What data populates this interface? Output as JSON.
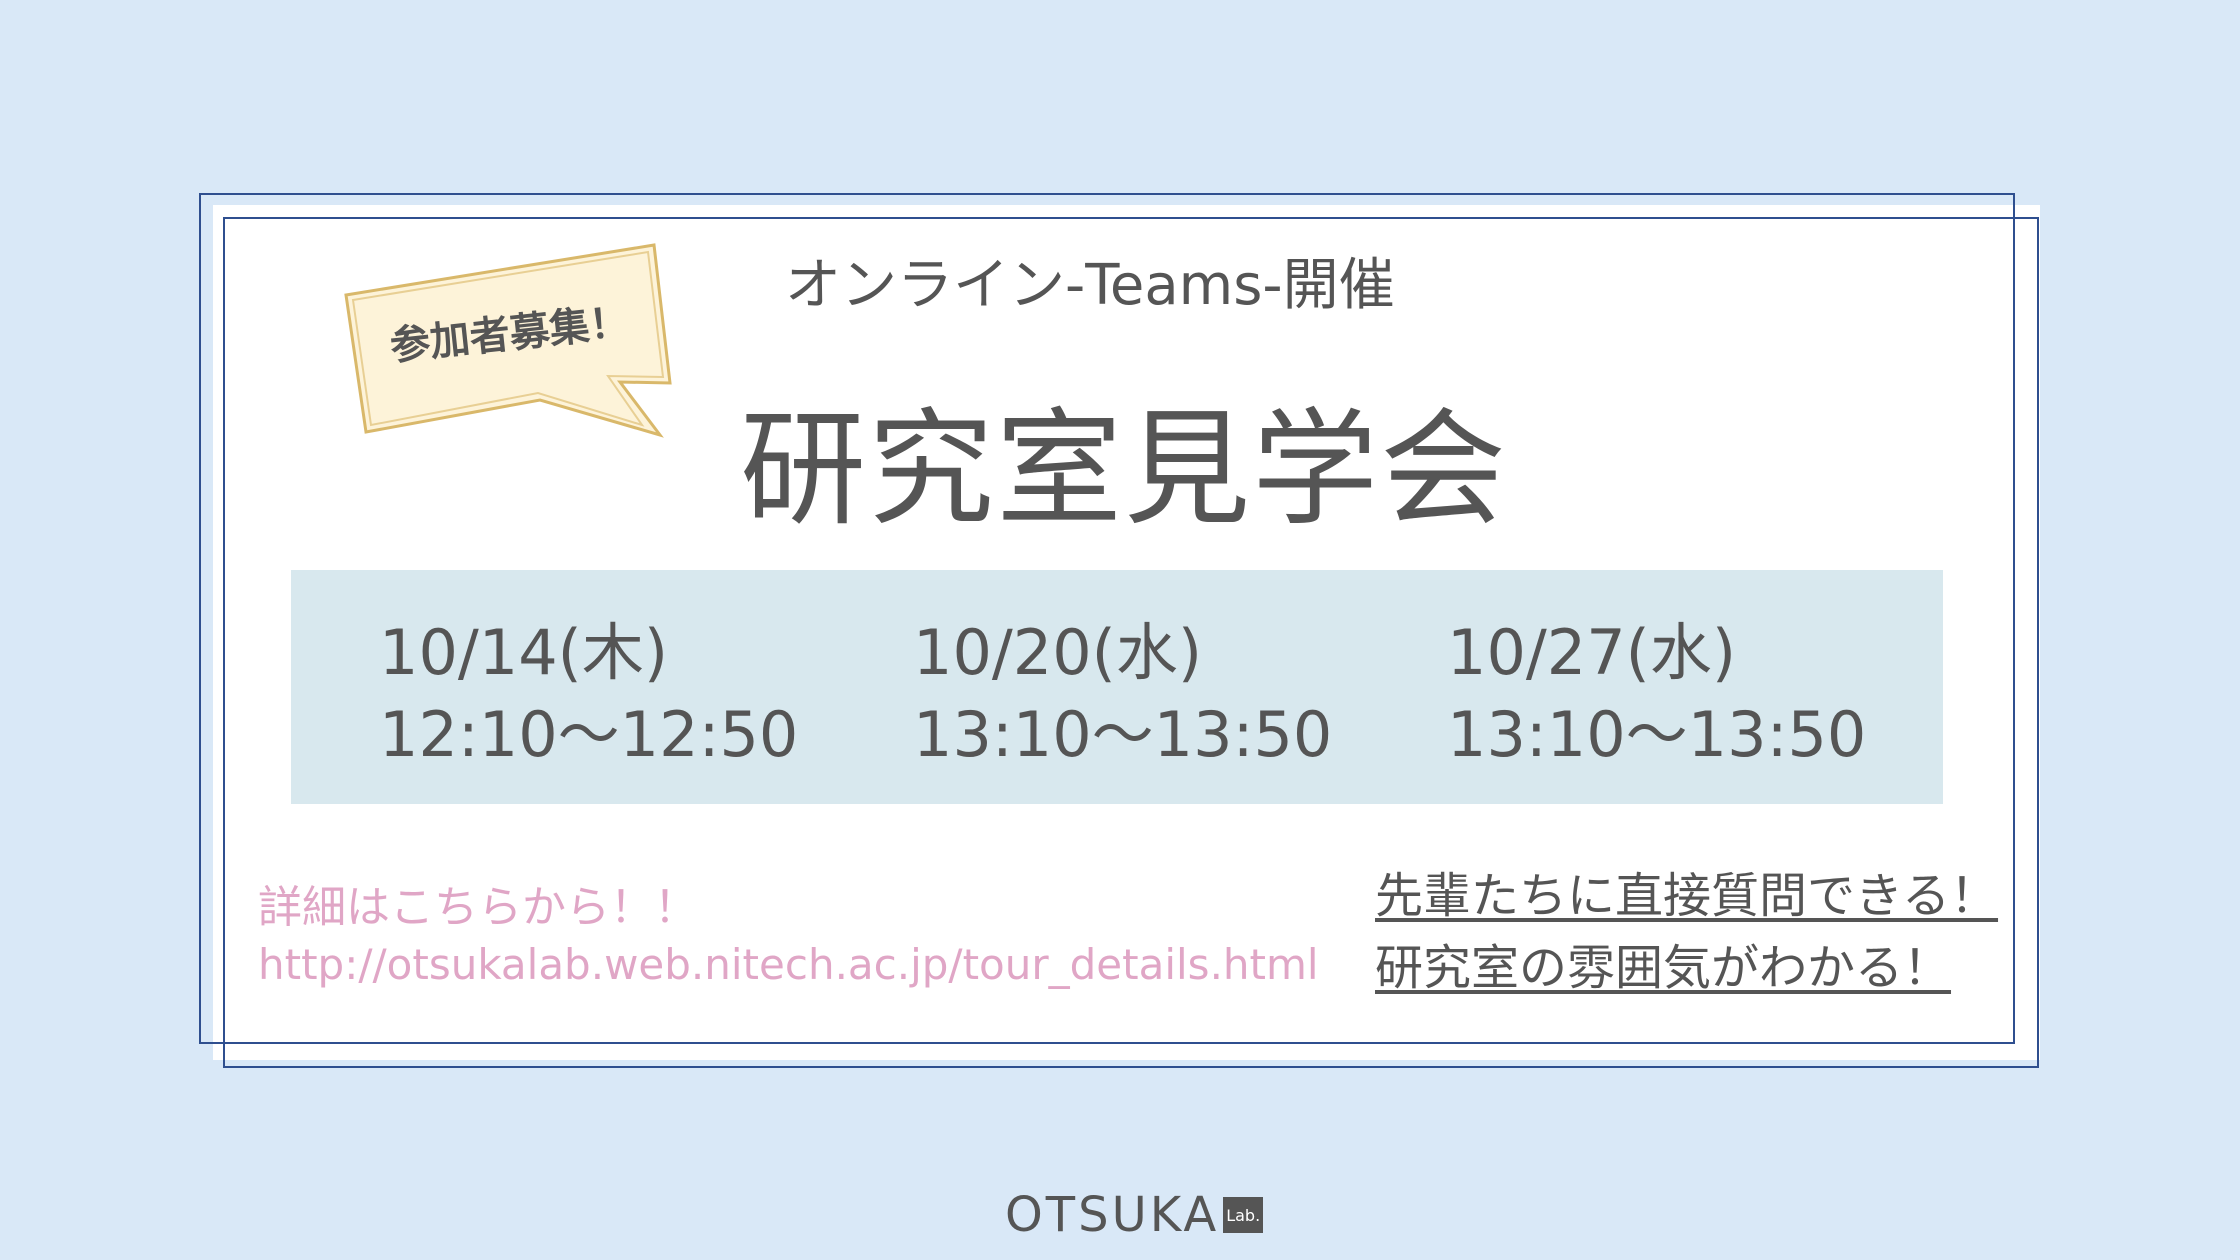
{
  "badge": {
    "label": "参加者募集！"
  },
  "header": {
    "subtitle": "オンライン-Teams-開催",
    "title": "研究室見学会"
  },
  "schedule": [
    {
      "date": "10/14(木)",
      "time": "12:10〜12:50"
    },
    {
      "date": "10/20(水)",
      "time": "13:10〜13:50"
    },
    {
      "date": "10/27(水)",
      "time": "13:10〜13:50"
    }
  ],
  "details": {
    "lead": "詳細はこちらから！！",
    "url": "http://otsukalab.web.nitech.ac.jp/tour_details.html"
  },
  "points": [
    "先輩たちに直接質問できる！",
    "研究室の雰囲気がわかる！"
  ],
  "logo": {
    "word": "OTSUKA",
    "tag": "Lab."
  },
  "colors": {
    "background": "#d9e8f7",
    "frame": "#2f4f8f",
    "schedule_band": "#d8e8ee",
    "link": "#e0a6c6",
    "badge_fill": "#fdf3d9",
    "badge_stroke": "#d9b86a",
    "text": "#555555"
  }
}
